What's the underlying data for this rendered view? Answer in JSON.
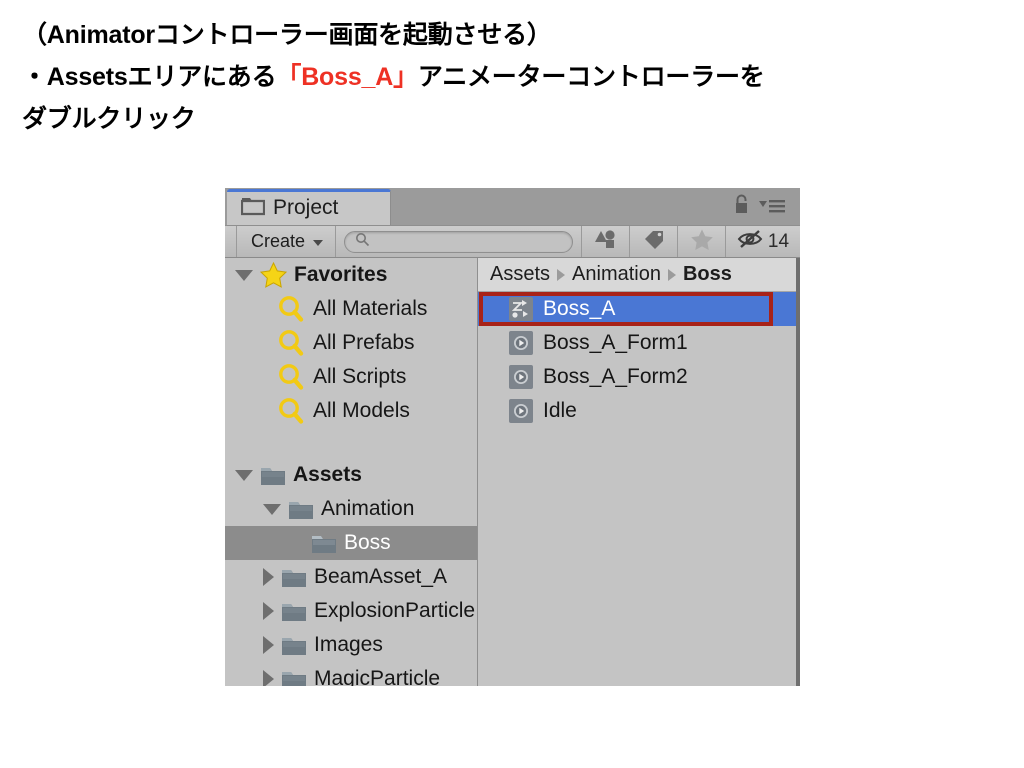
{
  "instructions": {
    "line1": "（Animatorコントローラー画面を起動させる）",
    "line2_pre": "・Assetsエリアにある",
    "line2_highlight": "「Boss_A」",
    "line2_post": "アニメーターコントローラーを",
    "line3": "ダブルクリック",
    "highlight_color": "#ee3124"
  },
  "window": {
    "tab": {
      "label": "Project",
      "icon": "project-folder-icon"
    },
    "header_icons": {
      "lock": "lock-icon",
      "menu": "hamburger-menu-icon"
    },
    "toolbar": {
      "create_label": "Create",
      "search_placeholder": "",
      "search_value": "",
      "search_icon": "search-icon",
      "filter_type_icon": "shapes-filter-icon",
      "filter_label_icon": "tag-filter-icon",
      "favorite_icon": "star-icon",
      "hidden_icon": "eye-hidden-icon",
      "hidden_count": "14"
    },
    "tree": {
      "items": [
        {
          "label": "Favorites",
          "icon": "star-icon",
          "arrow": "open",
          "indent": 0,
          "bold": true,
          "selected": false
        },
        {
          "label": "All Materials",
          "icon": "search-icon",
          "arrow": "none",
          "indent": 1,
          "bold": false,
          "selected": false
        },
        {
          "label": "All Prefabs",
          "icon": "search-icon",
          "arrow": "none",
          "indent": 1,
          "bold": false,
          "selected": false
        },
        {
          "label": "All Scripts",
          "icon": "search-icon",
          "arrow": "none",
          "indent": 1,
          "bold": false,
          "selected": false
        },
        {
          "label": "All Models",
          "icon": "search-icon",
          "arrow": "none",
          "indent": 1,
          "bold": false,
          "selected": false
        },
        {
          "label": "Assets",
          "icon": "folder-icon",
          "arrow": "open",
          "indent": 0,
          "bold": true,
          "selected": false
        },
        {
          "label": "Animation",
          "icon": "folder-icon",
          "arrow": "open",
          "indent": 1,
          "bold": false,
          "selected": false
        },
        {
          "label": "Boss",
          "icon": "folder-icon",
          "arrow": "none",
          "indent": 2,
          "bold": false,
          "selected": true
        },
        {
          "label": "BeamAsset_A",
          "icon": "folder-icon",
          "arrow": "closed",
          "indent": 1,
          "bold": false,
          "selected": false
        },
        {
          "label": "ExplosionParticle",
          "icon": "folder-icon",
          "arrow": "closed",
          "indent": 1,
          "bold": false,
          "selected": false
        },
        {
          "label": "Images",
          "icon": "folder-icon",
          "arrow": "closed",
          "indent": 1,
          "bold": false,
          "selected": false
        },
        {
          "label": "MagicParticle",
          "icon": "folder-icon",
          "arrow": "closed",
          "indent": 1,
          "bold": false,
          "selected": false
        }
      ]
    },
    "breadcrumb": {
      "crumbs": [
        "Assets",
        "Animation",
        "Boss"
      ]
    },
    "assets": {
      "items": [
        {
          "label": "Boss_A",
          "icon": "animator-controller-icon",
          "selected": true,
          "highlighted": true
        },
        {
          "label": "Boss_A_Form1",
          "icon": "animation-clip-icon",
          "selected": false,
          "highlighted": false
        },
        {
          "label": "Boss_A_Form2",
          "icon": "animation-clip-icon",
          "selected": false,
          "highlighted": false
        },
        {
          "label": "Idle",
          "icon": "animation-clip-icon",
          "selected": false,
          "highlighted": false
        }
      ]
    },
    "colors": {
      "selection_blue": "#4a77d4",
      "annotation_red": "#a82318",
      "panel_gray": "#c4c4c4",
      "tree_selected_gray": "#8c8c8c"
    }
  }
}
